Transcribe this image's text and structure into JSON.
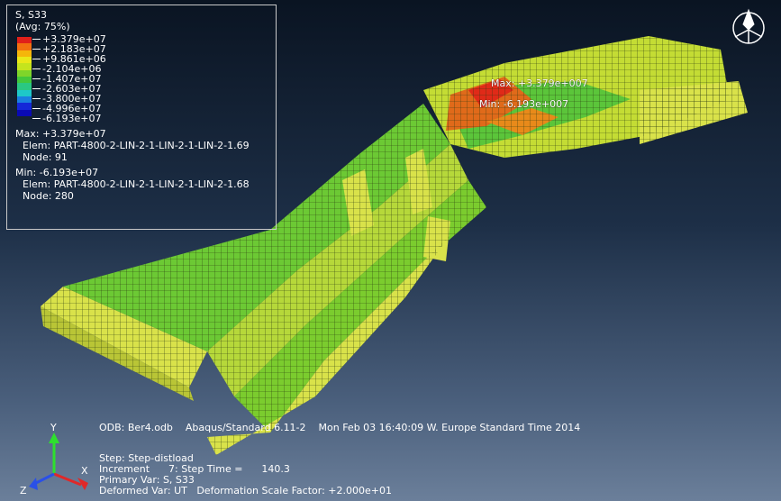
{
  "legend": {
    "title": "S, S33",
    "avg": "(Avg: 75%)",
    "colors": [
      "#e0201a",
      "#f27010",
      "#f5b60a",
      "#eae818",
      "#c5e41d",
      "#7fd52a",
      "#43c83c",
      "#2ac882",
      "#1ec8c8",
      "#1a7fe0",
      "#1428d8",
      "#0a0ab4"
    ],
    "levels": [
      "+3.379e+07",
      "+2.183e+07",
      "+9.861e+06",
      "-2.104e+06",
      "-1.407e+07",
      "-2.603e+07",
      "-3.800e+07",
      "-4.996e+07",
      "-6.193e+07"
    ],
    "max_label": "Max: +3.379e+07",
    "max_elem": "Elem: PART-4800-2-LIN-2-1-LIN-2-1-LIN-2-1.69",
    "max_node": "Node: 91",
    "min_label": "Min: -6.193e+07",
    "min_elem": "Elem: PART-4800-2-LIN-2-1-LIN-2-1-LIN-2-1.68",
    "min_node": "Node: 280"
  },
  "model_labels": {
    "max": "Max: +3.379e+007",
    "min": "Min: -6.193e+007"
  },
  "footer": {
    "odb": "ODB: Ber4.odb    Abaqus/Standard 6.11-2    Mon Feb 03 16:40:09 W. Europe Standard Time 2014",
    "step": "Step: Step-distload",
    "increment": "Increment      7: Step Time =      140.3",
    "primary": "Primary Var: S, S33",
    "deformed": "Deformed Var: UT   Deformation Scale Factor: +2.000e+01"
  },
  "triad": {
    "x": "X",
    "y": "Y",
    "z": "Z"
  }
}
